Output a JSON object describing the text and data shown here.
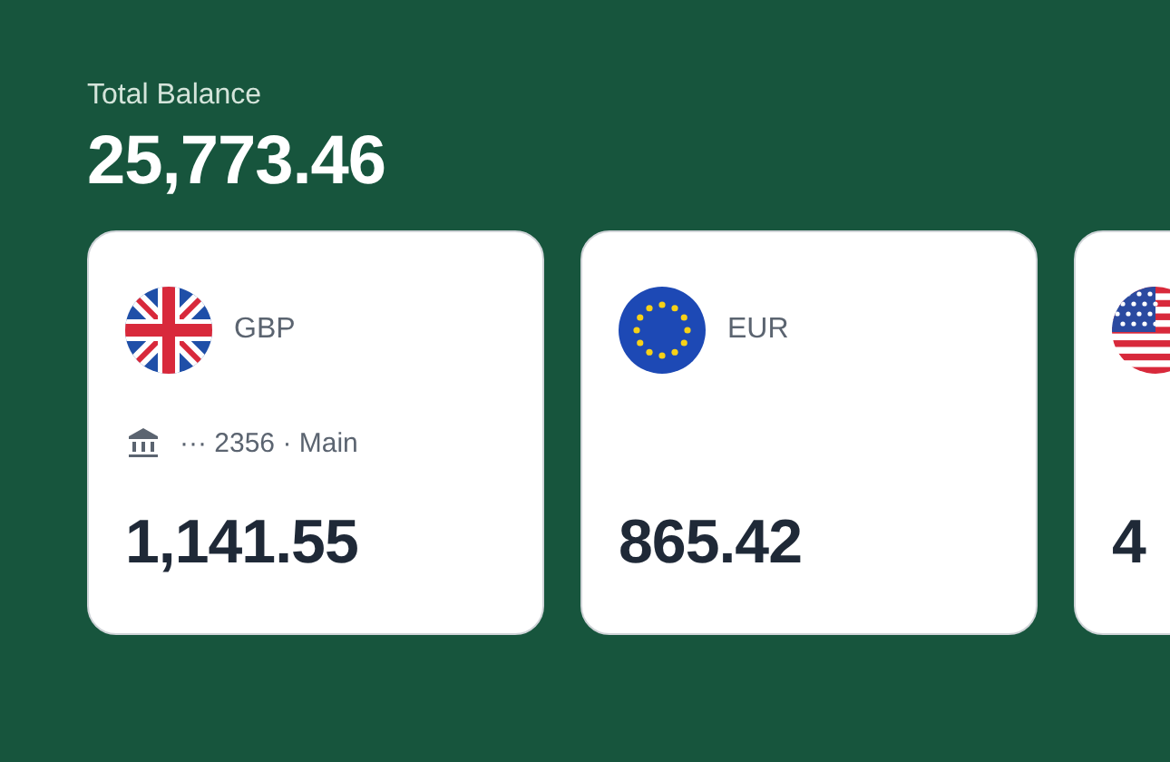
{
  "total": {
    "label": "Total Balance",
    "amount": "25,773.46"
  },
  "accounts": [
    {
      "kind": "gb",
      "currency": "GBP",
      "account": "··· 2356 · Main",
      "amount": "1,141.55"
    },
    {
      "kind": "eu",
      "currency": "EUR",
      "amount": "865.42"
    },
    {
      "kind": "us",
      "amount": "4"
    }
  ]
}
